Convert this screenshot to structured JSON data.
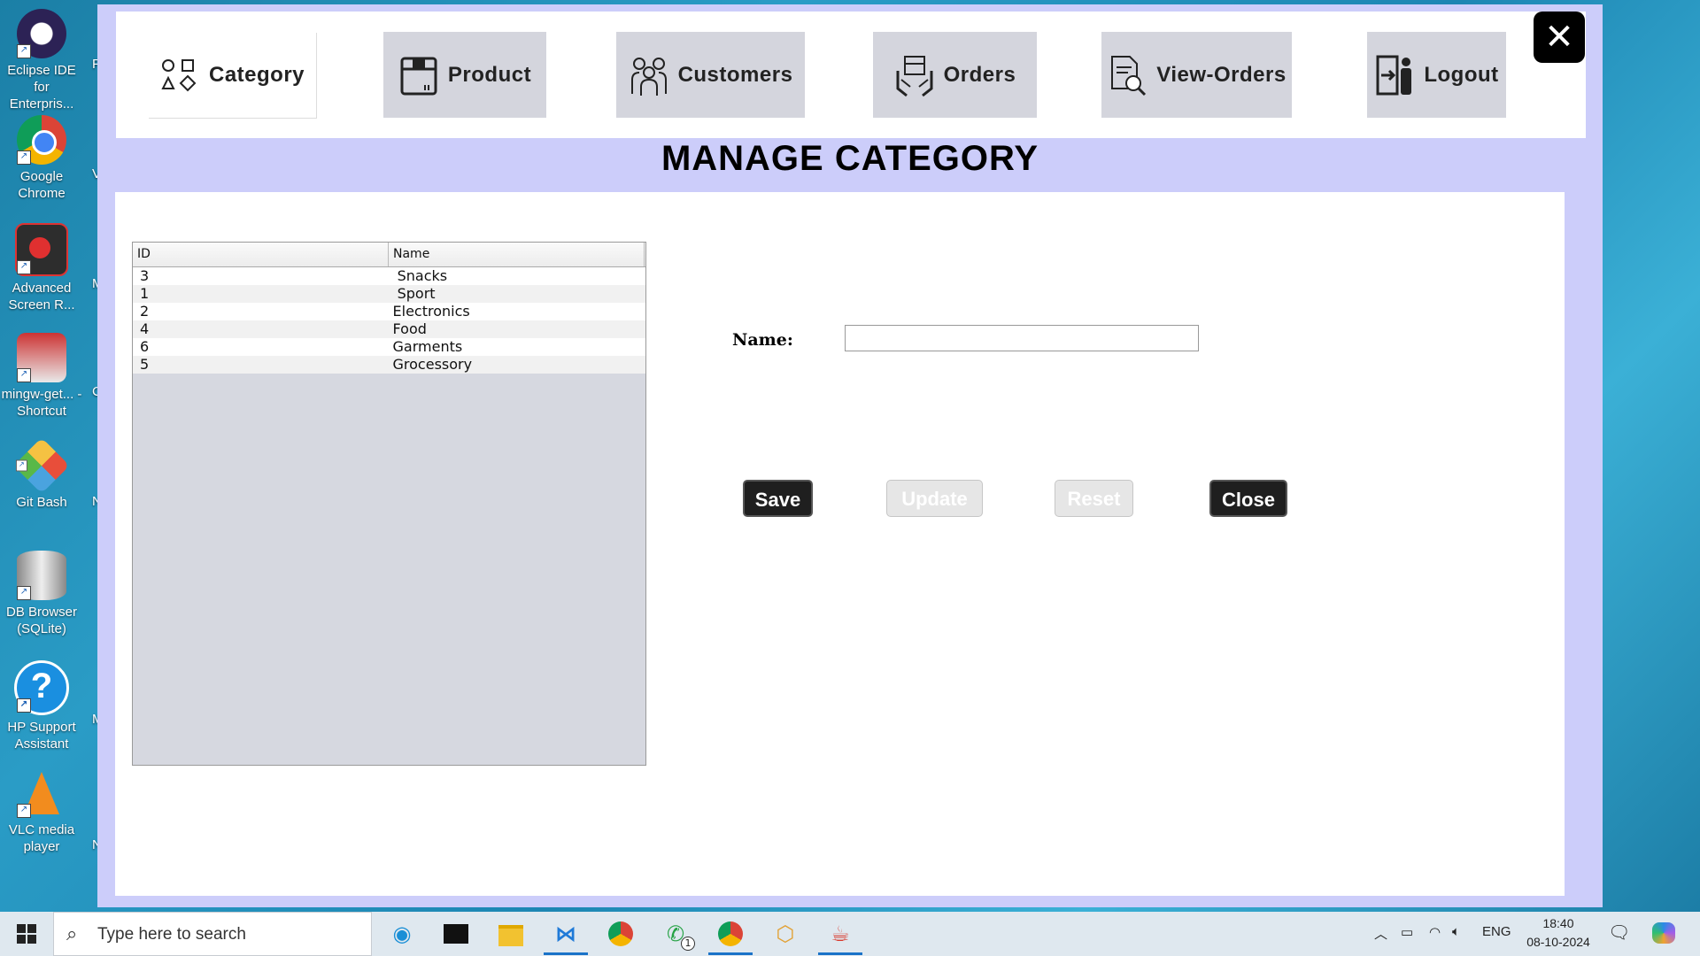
{
  "desktop": {
    "icons": [
      {
        "label": "Eclipse IDE for Enterpris...",
        "icon": "eclipse-icon"
      },
      {
        "label": "Google Chrome",
        "icon": "chrome-icon"
      },
      {
        "label": "Advanced Screen R...",
        "icon": "screen-recorder-icon"
      },
      {
        "label": "mingw-get... - Shortcut",
        "icon": "mingw-icon"
      },
      {
        "label": "Git Bash",
        "icon": "git-bash-icon"
      },
      {
        "label": "DB Browser (SQLite)",
        "icon": "database-icon"
      },
      {
        "label": "HP Support Assistant",
        "icon": "help-icon"
      },
      {
        "label": "VLC media player",
        "icon": "vlc-icon"
      }
    ],
    "edge_letters": [
      "F",
      "V",
      "M",
      "C",
      "N",
      "M",
      "N"
    ]
  },
  "nav": {
    "category": "Category",
    "product": "Product",
    "customers": "Customers",
    "orders": "Orders",
    "view_orders": "View-Orders",
    "logout": "Logout",
    "close_glyph": "✕"
  },
  "page": {
    "title": "MANAGE CATEGORY"
  },
  "table": {
    "headers": [
      "ID",
      "Name"
    ],
    "rows": [
      {
        "id": "3",
        "name": " Snacks"
      },
      {
        "id": "1",
        "name": " Sport"
      },
      {
        "id": "2",
        "name": "Electronics"
      },
      {
        "id": "4",
        "name": "Food"
      },
      {
        "id": "6",
        "name": "Garments"
      },
      {
        "id": "5",
        "name": "Grocessory"
      }
    ]
  },
  "form": {
    "name_label": "Name:",
    "name_value": "",
    "save": "Save",
    "update": "Update",
    "reset": "Reset",
    "close": "Close"
  },
  "taskbar": {
    "search_placeholder": "Type here to search",
    "language": "ENG",
    "time": "18:40",
    "date": "08-10-2024",
    "whatsapp_badge": "1"
  },
  "colors": {
    "app_background": "#cccdfa",
    "nav_button": "#d4d5dd",
    "dark_button": "#1f1f1f",
    "taskbar": "#dfe8ef"
  }
}
